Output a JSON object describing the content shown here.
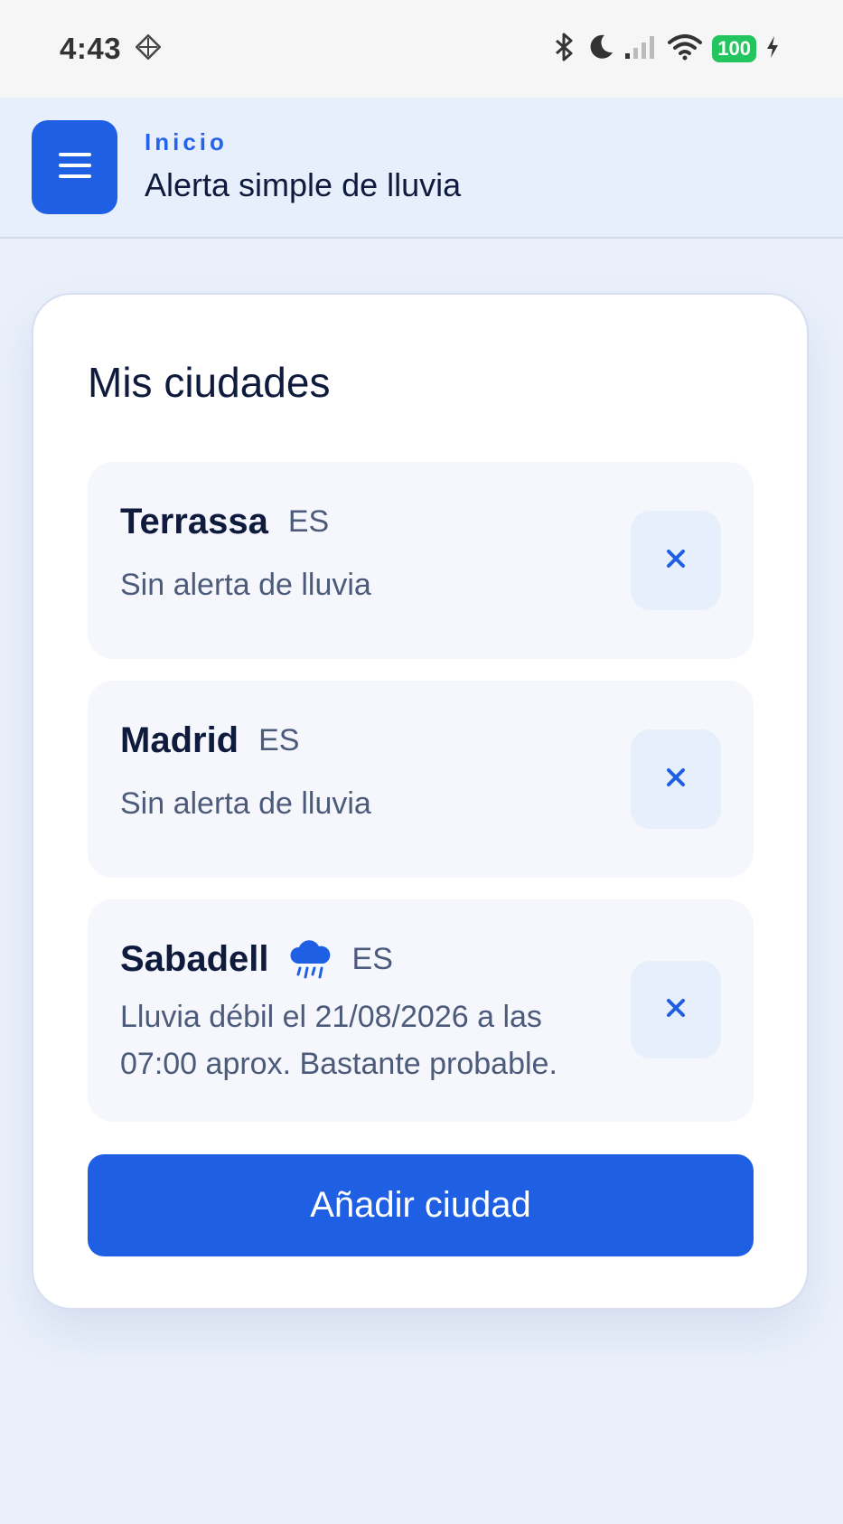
{
  "status_bar": {
    "time": "4:43",
    "battery": "100"
  },
  "header": {
    "breadcrumb": "Inicio",
    "title": "Alerta simple de lluvia"
  },
  "main": {
    "title": "Mis ciudades",
    "cities": [
      {
        "name": "Terrassa",
        "country": "ES",
        "status": "Sin alerta de lluvia",
        "icon": null
      },
      {
        "name": "Madrid",
        "country": "ES",
        "status": "Sin alerta de lluvia",
        "icon": null
      },
      {
        "name": "Sabadell",
        "country": "ES",
        "status_line1": "Lluvia débil el 21/08/2026 a las",
        "status_line2": "07:00 aprox. Bastante probable.",
        "icon": "rain-cloud-icon"
      }
    ],
    "add_button": "Añadir ciudad"
  },
  "colors": {
    "accent": "#1f5fe3",
    "title_text": "#0f1b3d",
    "muted_text": "#4d5b7a",
    "battery": "#22c55e"
  }
}
